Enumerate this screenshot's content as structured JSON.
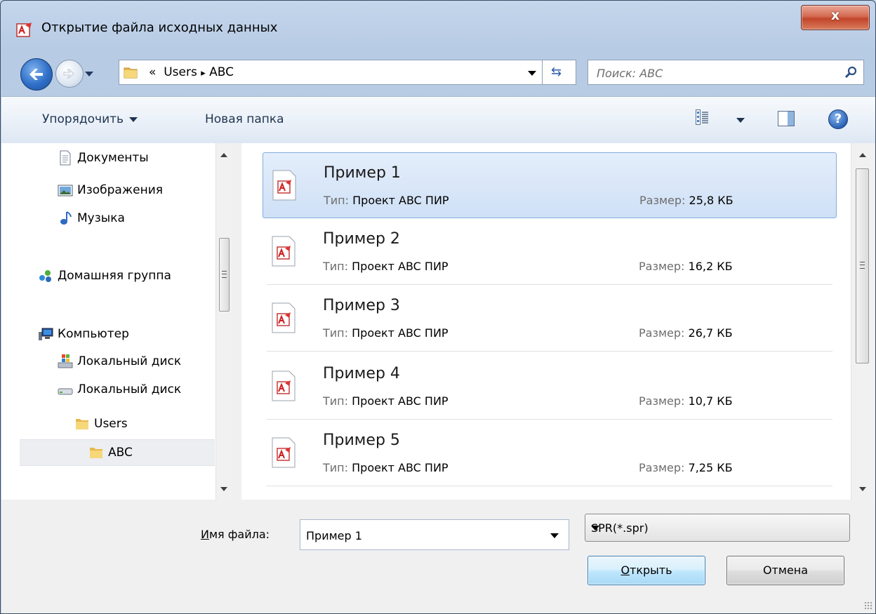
{
  "window": {
    "title": "Открытие файла исходных данных",
    "close_label": "x"
  },
  "nav": {
    "address": {
      "prefix": "«",
      "crumbs": [
        "Users",
        "ABC"
      ],
      "separator": "▸"
    },
    "search_placeholder": "Поиск: ABC"
  },
  "toolbar": {
    "organize_label": "Упорядочить",
    "new_folder_label": "Новая папка",
    "help_label": "?"
  },
  "sidebar": {
    "items": [
      {
        "label": "Документы",
        "icon": "documents-icon"
      },
      {
        "label": "Изображения",
        "icon": "pictures-icon"
      },
      {
        "label": "Музыка",
        "icon": "music-icon"
      },
      {
        "label": "Домашняя группа",
        "icon": "homegroup-icon"
      },
      {
        "label": "Компьютер",
        "icon": "computer-icon"
      },
      {
        "label": "Локальный диск",
        "icon": "system-drive-icon"
      },
      {
        "label": "Локальный диск",
        "icon": "drive-icon"
      },
      {
        "label": "Users",
        "icon": "folder-icon"
      },
      {
        "label": "ABC",
        "icon": "folder-icon",
        "selected": true
      }
    ]
  },
  "files": {
    "type_label": "Тип:",
    "size_label": "Размер:",
    "items": [
      {
        "name": "Пример 1",
        "type": "Проект ABC ПИР",
        "size": "25,8 КБ",
        "selected": true
      },
      {
        "name": "Пример 2",
        "type": "Проект ABC ПИР",
        "size": "16,2 КБ"
      },
      {
        "name": "Пример 3",
        "type": "Проект ABC ПИР",
        "size": "26,7 КБ"
      },
      {
        "name": "Пример 4",
        "type": "Проект ABC ПИР",
        "size": "10,7 КБ"
      },
      {
        "name": "Пример 5",
        "type": "Проект ABC ПИР",
        "size": "7,25 КБ"
      }
    ]
  },
  "bottom": {
    "filename_label_access": "И",
    "filename_label_rest": "мя файла:",
    "filename_value": "Пример 1",
    "filetype_value": "SPR(*.spr)",
    "open_access": "О",
    "open_rest": "ткрыть",
    "cancel_label": "Отмена"
  },
  "colors": {
    "accent": "#3c7fb1",
    "selection": "#cfe0f6",
    "close": "#c2452b"
  }
}
